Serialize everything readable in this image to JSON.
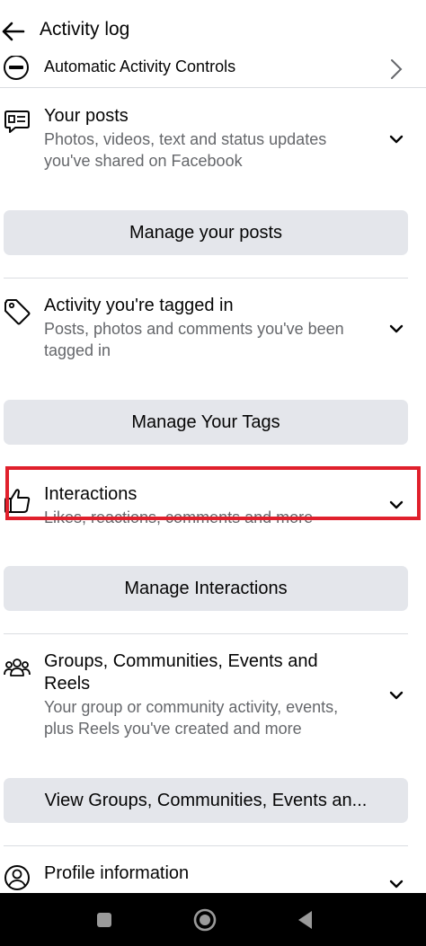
{
  "header": {
    "title": "Activity log"
  },
  "automatic_controls": {
    "label": "Automatic Activity Controls"
  },
  "sections": [
    {
      "title": "Your posts",
      "desc_line1": "Photos, videos, text and status updates",
      "desc_line2": "you've shared on Facebook",
      "button": "Manage your posts",
      "icon": "post-icon"
    },
    {
      "title": "Activity you're tagged in",
      "desc_line1": "Posts, photos and comments you've been",
      "desc_line2": "tagged in",
      "button": "Manage Your Tags",
      "icon": "tag-icon"
    },
    {
      "title": "Interactions",
      "desc_line1": "Likes, reactions, comments and more",
      "button": "Manage Interactions",
      "icon": "thumbs-up-icon"
    },
    {
      "title_line1": "Groups, Communities, Events and",
      "title_line2": "Reels",
      "desc_line1": "Your group or community activity, events,",
      "desc_line2": "plus Reels you've created and more",
      "button": "View Groups, Communities, Events an...",
      "icon": "people-icon"
    },
    {
      "title": "Profile information",
      "icon": "profile-icon"
    }
  ],
  "colors": {
    "highlight": "#e0202c",
    "button_bg": "#e4e6eb",
    "secondary_text": "#65676b"
  }
}
